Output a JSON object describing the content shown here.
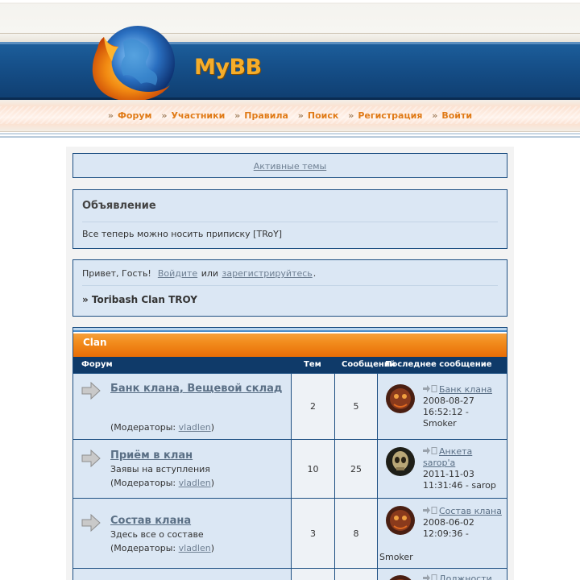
{
  "header": {
    "brand": "MyBB",
    "logo_icon": "firefox-logo-icon"
  },
  "menu": {
    "items": [
      "Форум",
      "Участники",
      "Правила",
      "Поиск",
      "Регистрация",
      "Войти"
    ]
  },
  "active_topics": {
    "label": "Активные темы"
  },
  "announcement": {
    "title": "Объявление",
    "text": "Все теперь можно носить приписку [TRoY]"
  },
  "guest": {
    "greeting": "Привет, Гость!",
    "login_link": "Войдите",
    "or": "или",
    "register_link": "зарегистрируйтесь",
    "period": ".",
    "breadcrumb": "» Toribash Clan TROY"
  },
  "category": {
    "title": "Clan",
    "columns": {
      "forum": "Форум",
      "threads": "Тем",
      "posts": "Сообщений",
      "last_post": "Последнее сообщение"
    },
    "moderators_label": "(Модераторы:",
    "moderators_close": ")",
    "rows": [
      {
        "name": "Банк клана, Вещевой склад",
        "description": "",
        "moderator": "vladlen",
        "threads": "2",
        "posts": "5",
        "last_title": "Банк клана",
        "last_date": "2008-08-27",
        "last_time": "16:52:12 -",
        "last_author": "Smoker",
        "avatar_icon": "flame-face-avatar"
      },
      {
        "name": "Приём в клан",
        "description": "Заявы на вступления",
        "moderator": "vladlen",
        "threads": "10",
        "posts": "25",
        "last_title": "Анкета sarop'a",
        "last_date": "2011-11-03",
        "last_time": "11:31:46 - sarop",
        "last_author": "",
        "avatar_icon": "skull-avatar"
      },
      {
        "name": "Состав клана",
        "description": "Здесь все о составе",
        "moderator": "vladlen",
        "threads": "3",
        "posts": "8",
        "last_title": "Состав клана",
        "last_date": "2008-06-02",
        "last_time": "12:09:36 -",
        "last_author": "Smoker",
        "avatar_icon": "flame-face-avatar"
      },
      {
        "last_title": "Должности",
        "avatar_icon": "flame-face-avatar"
      }
    ]
  }
}
